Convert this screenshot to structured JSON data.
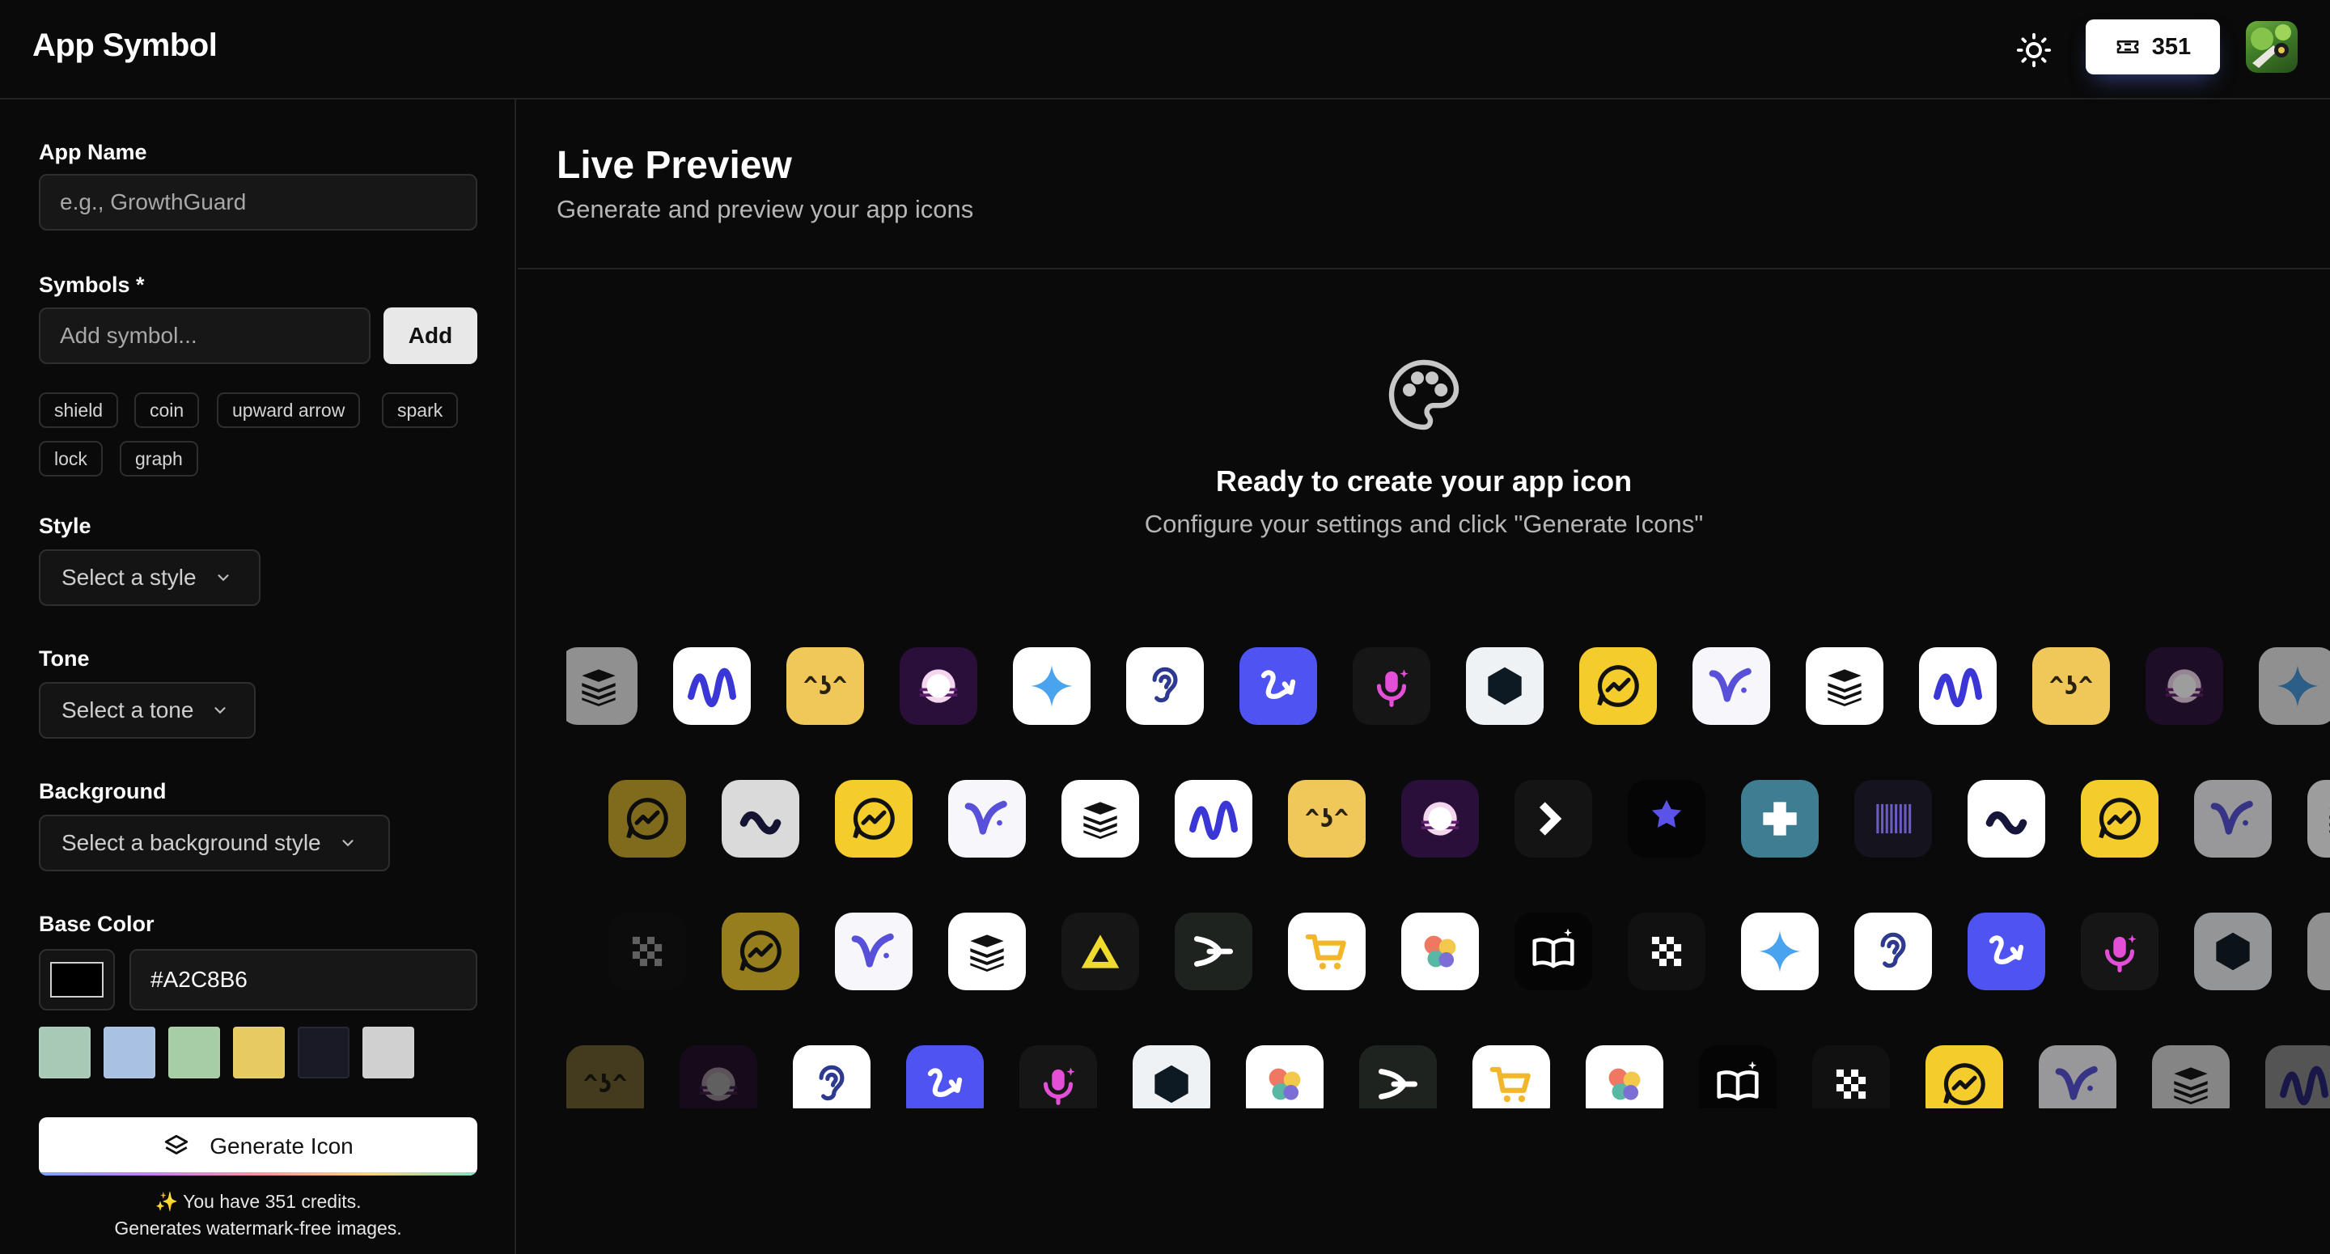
{
  "header": {
    "title": "App Symbol",
    "theme_icon": "sun-icon",
    "credits": "351",
    "credits_icon": "ticket-icon",
    "avatar_icon": "user-avatar"
  },
  "form": {
    "app_name": {
      "label": "App Name",
      "placeholder": "e.g., GrowthGuard",
      "value": ""
    },
    "symbols": {
      "label": "Symbols *",
      "placeholder": "Add symbol...",
      "add_label": "Add",
      "suggestions": [
        "shield",
        "coin",
        "upward arrow",
        "spark",
        "lock",
        "graph"
      ]
    },
    "style": {
      "label": "Style",
      "value": "Select a style"
    },
    "tone": {
      "label": "Tone",
      "value": "Select a tone"
    },
    "background": {
      "label": "Background",
      "value": "Select a background style"
    },
    "base_color": {
      "label": "Base Color",
      "value": "#A2C8B6",
      "swatch": "#000000",
      "presets": [
        "#a9c9b7",
        "#a9c1e3",
        "#a7cda5",
        "#e6cb63",
        "#1a1a26",
        "#d0d0d0"
      ]
    },
    "generate_label": "Generate Icon",
    "credits_line": "✨ You have 351 credits.",
    "watermark_line": "Generates watermark-free images."
  },
  "preview": {
    "title": "Live Preview",
    "subtitle": "Generate and preview your app icons",
    "empty_icon": "palette-icon",
    "empty_title": "Ready to create your app icon",
    "empty_subtitle": "Configure your settings and click \"Generate Icons\""
  },
  "gallery": {
    "rows": [
      [
        "stack-icon",
        "wave-icon",
        "kaomoji-face-icon",
        "sunset-icon",
        "sparkle-icon",
        "ear-icon",
        "squiggle-arrow-icon",
        "voice-mic-icon",
        "hexagon-icon",
        "chat-graph-icon",
        "v-check-icon",
        "stack-icon",
        "wave-icon",
        "kaomoji-face-icon",
        "sunset-icon",
        "sparkle-icon",
        "ear-icon"
      ],
      [
        "chat-graph-icon",
        "tilde-icon",
        "chat-graph-icon",
        "v-check-icon",
        "stack-icon",
        "wave-icon",
        "kaomoji-face-icon",
        "sunset-icon",
        "chevron-right-icon",
        "puzzle-icon",
        "health-cross-icon",
        "barcode-icon",
        "tilde-icon",
        "chat-graph-icon",
        "v-check-icon",
        "stack-icon",
        "wave-icon"
      ],
      [
        "checker-icon",
        "chat-graph-icon",
        "v-check-icon",
        "stack-icon",
        "triangle-icon",
        "split-arrow-icon",
        "cart-icon",
        "petals-icon",
        "book-sparkle-icon",
        "checker-icon",
        "sparkle-icon",
        "ear-icon",
        "squiggle-arrow-icon",
        "voice-mic-icon",
        "hexagon-icon",
        "petals-icon",
        "book-sparkle-icon"
      ],
      [
        "kaomoji-face-icon",
        "sunset-icon",
        "ear-icon",
        "squiggle-arrow-icon",
        "voice-mic-icon",
        "hexagon-icon",
        "petals-icon",
        "split-arrow-icon",
        "cart-icon",
        "petals-icon",
        "book-sparkle-icon",
        "checker-icon",
        "chat-graph-icon",
        "v-check-icon",
        "stack-icon",
        "wave-icon"
      ]
    ]
  }
}
